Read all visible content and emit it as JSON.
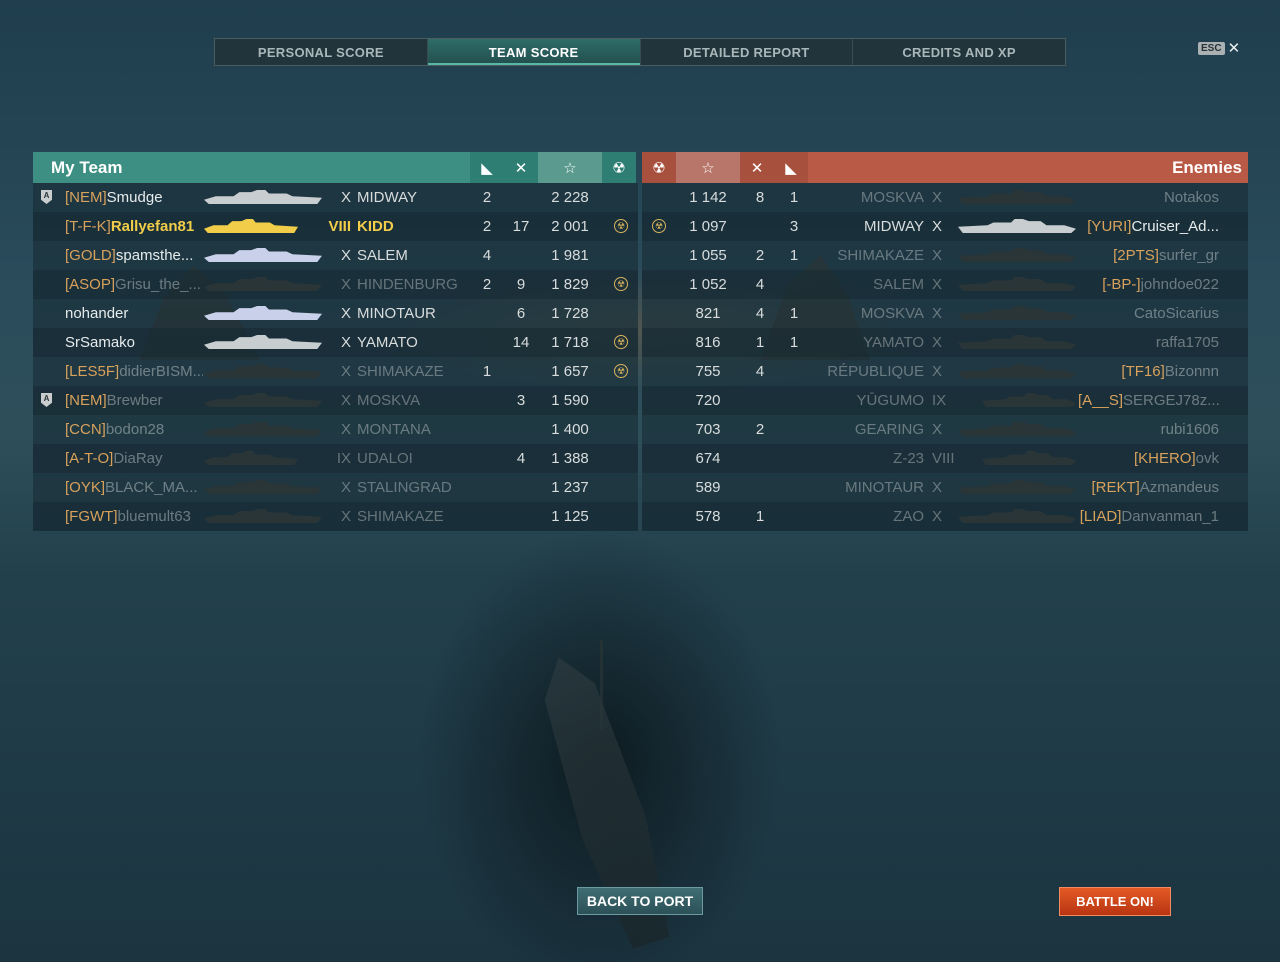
{
  "tabs": [
    "PERSONAL SCORE",
    "TEAM SCORE",
    "DETAILED REPORT",
    "CREDITS AND XP"
  ],
  "active_tab": 1,
  "esc_label": "ESC",
  "close_glyph": "✕",
  "my_team": {
    "title": "My Team",
    "header_icons": [
      "planes-destroyed-icon",
      "ships-destroyed-icon",
      "star-icon",
      "medal-icon"
    ],
    "header_glyphs": [
      "◣",
      "✕",
      "☆",
      "☢"
    ],
    "rows": [
      {
        "badge": "A",
        "clan": "[NEM]",
        "name": "Smudge",
        "tier": "X",
        "ship": "MIDWAY",
        "planes": "2",
        "kills": "",
        "exp": "2 228",
        "medal": false,
        "dim_name": false,
        "dim_ship": false,
        "ship_color": "#c8cdcf",
        "highlight": false
      },
      {
        "badge": "",
        "clan": "[T-F-K]",
        "name": "Rallyefan81",
        "tier": "VIII",
        "ship": "KIDD",
        "planes": "2",
        "kills": "17",
        "exp": "2 001",
        "medal": true,
        "dim_name": false,
        "dim_ship": false,
        "ship_color": "#f1cd4a",
        "highlight": true
      },
      {
        "badge": "",
        "clan": "[GOLD]",
        "name": "spamsthe...",
        "tier": "X",
        "ship": "SALEM",
        "planes": "4",
        "kills": "",
        "exp": "1 981",
        "medal": false,
        "dim_name": false,
        "dim_ship": false,
        "ship_color": "#c9d0ea",
        "highlight": false
      },
      {
        "badge": "",
        "clan": "[ASOP]",
        "name": "Grisu_the_...",
        "tier": "X",
        "ship": "HINDENBURG",
        "planes": "2",
        "kills": "9",
        "exp": "1 829",
        "medal": true,
        "dim_name": true,
        "dim_ship": true,
        "ship_color": "#2a3538",
        "highlight": false
      },
      {
        "badge": "",
        "clan": "",
        "name": "nohander",
        "tier": "X",
        "ship": "MINOTAUR",
        "planes": "",
        "kills": "6",
        "exp": "1 728",
        "medal": false,
        "dim_name": false,
        "dim_ship": false,
        "ship_color": "#c9d0ea",
        "highlight": false
      },
      {
        "badge": "",
        "clan": "",
        "name": "SrSamako",
        "tier": "X",
        "ship": "YAMATO",
        "planes": "",
        "kills": "14",
        "exp": "1 718",
        "medal": true,
        "dim_name": false,
        "dim_ship": false,
        "ship_color": "#c8cdcf",
        "highlight": false
      },
      {
        "badge": "",
        "clan": "[LES5F]",
        "name": "didierBISM...",
        "tier": "X",
        "ship": "SHIMAKAZE",
        "planes": "1",
        "kills": "",
        "exp": "1 657",
        "medal": true,
        "dim_name": true,
        "dim_ship": true,
        "ship_color": "#2a3538",
        "highlight": false
      },
      {
        "badge": "A",
        "clan": "[NEM]",
        "name": "Brewber",
        "tier": "X",
        "ship": "MOSKVA",
        "planes": "",
        "kills": "3",
        "exp": "1 590",
        "medal": false,
        "dim_name": true,
        "dim_ship": true,
        "ship_color": "#2a3538",
        "highlight": false
      },
      {
        "badge": "",
        "clan": "[CCN]",
        "name": "bodon28",
        "tier": "X",
        "ship": "MONTANA",
        "planes": "",
        "kills": "",
        "exp": "1 400",
        "medal": false,
        "dim_name": true,
        "dim_ship": true,
        "ship_color": "#2a3538",
        "highlight": false
      },
      {
        "badge": "",
        "clan": "[A-T-O]",
        "name": "DiaRay",
        "tier": "IX",
        "ship": "UDALOI",
        "planes": "",
        "kills": "4",
        "exp": "1 388",
        "medal": false,
        "dim_name": true,
        "dim_ship": true,
        "ship_color": "#2a3538",
        "highlight": false
      },
      {
        "badge": "",
        "clan": "[OYK]",
        "name": "BLACK_MA...",
        "tier": "X",
        "ship": "STALINGRAD",
        "planes": "",
        "kills": "",
        "exp": "1 237",
        "medal": false,
        "dim_name": true,
        "dim_ship": true,
        "ship_color": "#2a3538",
        "highlight": false
      },
      {
        "badge": "",
        "clan": "[FGWT]",
        "name": "bluemult63",
        "tier": "X",
        "ship": "SHIMAKAZE",
        "planes": "",
        "kills": "",
        "exp": "1 125",
        "medal": false,
        "dim_name": true,
        "dim_ship": true,
        "ship_color": "#2a3538",
        "highlight": false
      }
    ]
  },
  "enemies": {
    "title": "Enemies",
    "rows": [
      {
        "clan": "",
        "name": "Notakos",
        "tier": "X",
        "ship": "MOSKVA",
        "planes": "1",
        "kills": "8",
        "exp": "1 142",
        "medal": false,
        "dim_name": true,
        "dim_ship": true,
        "ship_color": "#2a3538"
      },
      {
        "clan": "[YURI]",
        "name": "Cruiser_Ad...",
        "tier": "X",
        "ship": "MIDWAY",
        "planes": "3",
        "kills": "",
        "exp": "1 097",
        "medal": true,
        "dim_name": false,
        "dim_ship": false,
        "ship_color": "#c8cdcf"
      },
      {
        "clan": "[2PTS]",
        "name": "surfer_gr",
        "tier": "X",
        "ship": "SHIMAKAZE",
        "planes": "1",
        "kills": "2",
        "exp": "1 055",
        "medal": false,
        "dim_name": true,
        "dim_ship": true,
        "ship_color": "#2a3538"
      },
      {
        "clan": "[-BP-]",
        "name": "johndoe022",
        "tier": "X",
        "ship": "SALEM",
        "planes": "",
        "kills": "4",
        "exp": "1 052",
        "medal": false,
        "dim_name": true,
        "dim_ship": true,
        "ship_color": "#2a3538"
      },
      {
        "clan": "",
        "name": "CatoSicarius",
        "tier": "X",
        "ship": "MOSKVA",
        "planes": "1",
        "kills": "4",
        "exp": "821",
        "medal": false,
        "dim_name": true,
        "dim_ship": true,
        "ship_color": "#2a3538"
      },
      {
        "clan": "",
        "name": "raffa1705",
        "tier": "X",
        "ship": "YAMATO",
        "planes": "1",
        "kills": "1",
        "exp": "816",
        "medal": false,
        "dim_name": true,
        "dim_ship": true,
        "ship_color": "#2a3538"
      },
      {
        "clan": "[TF16]",
        "name": "Bizonnn",
        "tier": "X",
        "ship": "RÉPUBLIQUE",
        "planes": "",
        "kills": "4",
        "exp": "755",
        "medal": false,
        "dim_name": true,
        "dim_ship": true,
        "ship_color": "#2a3538"
      },
      {
        "clan": "[A__S]",
        "name": "SERGEJ78z...",
        "tier": "IX",
        "ship": "YŪGUMO",
        "planes": "",
        "kills": "",
        "exp": "720",
        "medal": false,
        "dim_name": true,
        "dim_ship": true,
        "ship_color": "#2a3538"
      },
      {
        "clan": "",
        "name": "rubi1606",
        "tier": "X",
        "ship": "GEARING",
        "planes": "",
        "kills": "2",
        "exp": "703",
        "medal": false,
        "dim_name": true,
        "dim_ship": true,
        "ship_color": "#2a3538"
      },
      {
        "clan": "[KHERO]",
        "name": "ovk",
        "tier": "VIII",
        "ship": "Z-23",
        "planes": "",
        "kills": "",
        "exp": "674",
        "medal": false,
        "dim_name": true,
        "dim_ship": true,
        "ship_color": "#2a3538"
      },
      {
        "clan": "[REKT]",
        "name": "Azmandeus",
        "tier": "X",
        "ship": "MINOTAUR",
        "planes": "",
        "kills": "",
        "exp": "589",
        "medal": false,
        "dim_name": true,
        "dim_ship": true,
        "ship_color": "#2a3538"
      },
      {
        "clan": "[LIAD]",
        "name": "Danvanman_1",
        "tier": "X",
        "ship": "ZAO",
        "planes": "",
        "kills": "1",
        "exp": "578",
        "medal": false,
        "dim_name": true,
        "dim_ship": true,
        "ship_color": "#2a3538"
      }
    ]
  },
  "buttons": {
    "back": "BACK TO PORT",
    "battle": "BATTLE ON!"
  },
  "colors": {
    "my_team": "#3e8f83",
    "enemies": "#b85a45",
    "highlight": "#f1cd4a",
    "clan": "#d8a15c"
  }
}
